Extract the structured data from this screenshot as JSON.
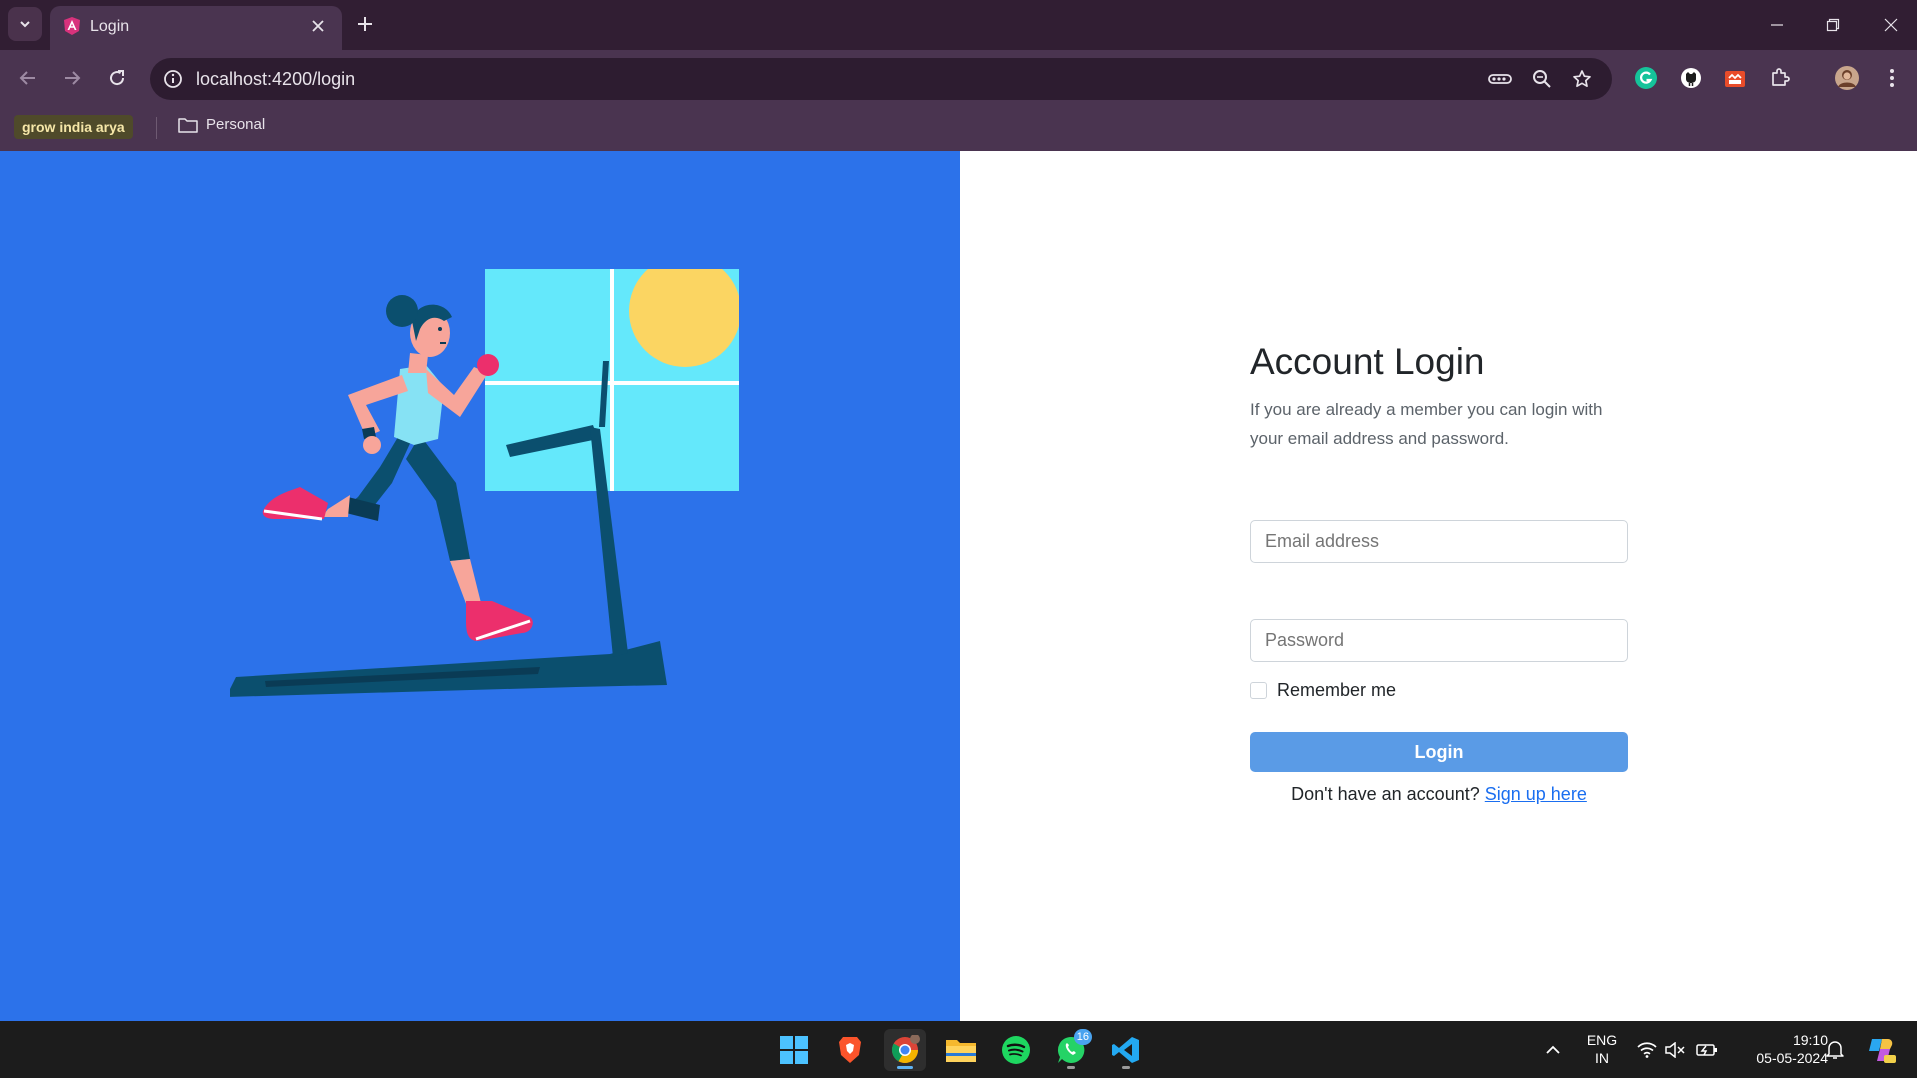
{
  "browser": {
    "tab_title": "Login",
    "url": "localhost:4200/login",
    "bookmarks": {
      "chip_label": "grow india arya",
      "folder_label": "Personal"
    }
  },
  "login": {
    "title": "Account Login",
    "subtitle": "If you are already a member you can login with your email address and password.",
    "email_placeholder": "Email address",
    "password_placeholder": "Password",
    "remember_label": "Remember me",
    "button_label": "Login",
    "signup_prompt": "Don't have an account?",
    "signup_link": "Sign up here"
  },
  "taskbar": {
    "whatsapp_badge": "16",
    "language": "ENG",
    "region": "IN",
    "time": "19:10",
    "date": "05-05-2024"
  },
  "colors": {
    "hero_background": "#2c72ea",
    "login_button": "#5a9be6",
    "link": "#1a6ef0",
    "browser_frame": "#4a3450"
  }
}
